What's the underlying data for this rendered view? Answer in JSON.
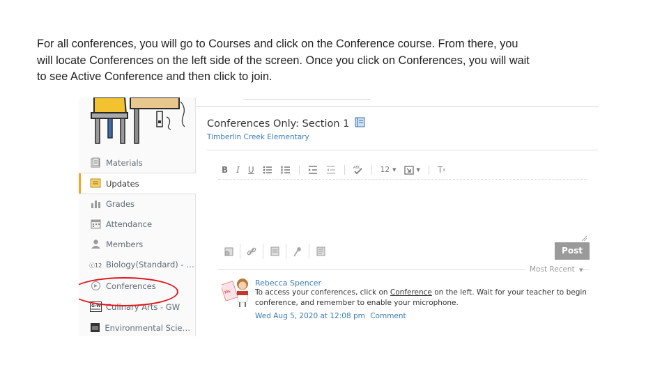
{
  "instructions": {
    "line1": "For all conferences, you will go to Courses and click on the Conference course.  From there, you",
    "line2": "will locate Conferences on the left side of the screen.  Once you click on Conferences, you will wait",
    "line3": "to see Active Conference and then click to join."
  },
  "sidebar": {
    "items": [
      {
        "label": "Materials",
        "icon": "materials-icon"
      },
      {
        "label": "Updates",
        "icon": "updates-icon"
      },
      {
        "label": "Grades",
        "icon": "grades-icon"
      },
      {
        "label": "Attendance",
        "icon": "attendance-icon"
      },
      {
        "label": "Members",
        "icon": "members-icon"
      },
      {
        "label": "Biology(Standard) - Sav...",
        "icon": "biology-icon"
      },
      {
        "label": "Conferences",
        "icon": "conferences-icon"
      },
      {
        "label": "Culinary Arts - GW",
        "icon": "culinary-icon"
      },
      {
        "label": "Environmental Science...",
        "icon": "environment-icon"
      }
    ],
    "active_index": 1,
    "highlight_color": "#e3141b"
  },
  "course": {
    "title": "Conferences Only: Section 1",
    "school": "Timberlin Creek Elementary"
  },
  "editor": {
    "bold": "B",
    "italic": "I",
    "underline": "U",
    "font_size": "12",
    "clear_format": "T",
    "clear_format_sub": "x",
    "post_label": "Post"
  },
  "feed": {
    "sort_label": "Most Recent",
    "post": {
      "author": "Rebecca Spencer",
      "text_before": "To access your conferences, click on ",
      "text_link": "Conference",
      "text_after": "  on the left.  Wait for your teacher to begin",
      "text_line2": "conference, and remember to enable your microphone.",
      "timestamp": "Wed Aug 5, 2020 at 12:08 pm",
      "comment_label": "Comment"
    }
  },
  "colors": {
    "accent_link": "#3a7bb5",
    "post_button": "#9a9a9a",
    "active_bar": "#f5a623"
  }
}
